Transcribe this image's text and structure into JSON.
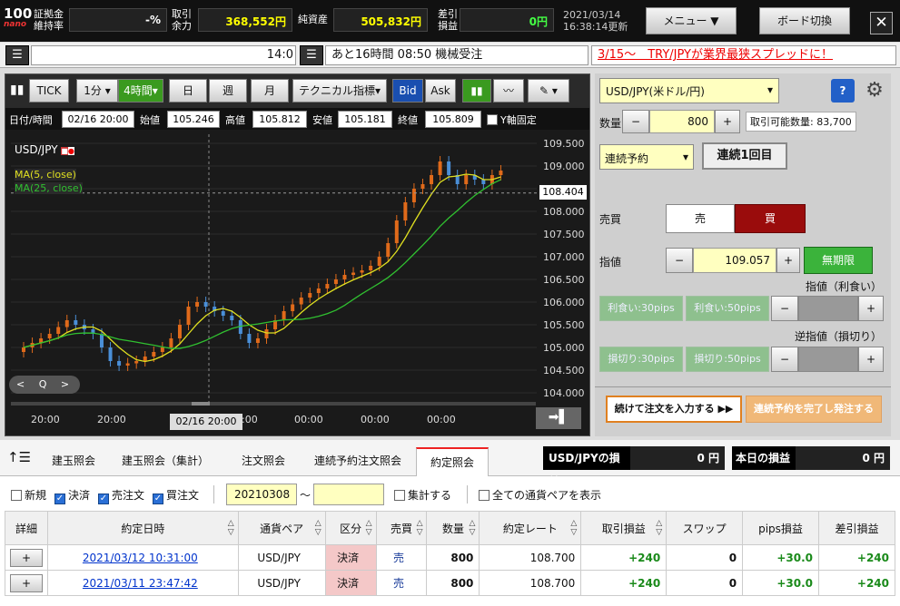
{
  "header": {
    "logo_top": "100",
    "logo_bottom": "nano",
    "margin_label": "証拠金\n維持率",
    "margin_value": "-%",
    "available_label": "取引\n余力",
    "available_value": "368,552円",
    "net_assets_label": "純資産",
    "net_assets_value": "505,832円",
    "pl_label": "差引\n損益",
    "pl_value": "0円",
    "date": "2021/03/14",
    "update_time": "16:38:14更新",
    "menu_button": "メニュー ▼",
    "board_button": "ボード切換",
    "close": "✕"
  },
  "status": {
    "clock": "14:0",
    "message": "あと16時間 08:50 機械受注",
    "ticker": "3/15～　TRY/JPYが業界最狭スプレッドに！"
  },
  "chart_toolbar": {
    "tick": "TICK",
    "min1": "1分",
    "h4": "4時間",
    "day": "日",
    "week": "週",
    "month": "月",
    "technical": "テクニカル指標",
    "bid": "Bid",
    "ask": "Ask"
  },
  "ohlc": {
    "datetime_label": "日付/時間",
    "datetime": "02/16 20:00",
    "open_label": "始値",
    "open": "105.246",
    "high_label": "高値",
    "high": "105.812",
    "low_label": "安値",
    "low": "105.181",
    "close_label": "終値",
    "close": "105.809",
    "yfix": "Y軸固定"
  },
  "chart_labels": {
    "pair": "USD/JPY",
    "ma5": "MA(5, close)",
    "ma25": "MA(25, close)",
    "current_price": "108.404",
    "crosshair_time": "02/16 20:00",
    "nav_left": "<",
    "nav_zoom": "Q",
    "nav_right": ">"
  },
  "chart_data": {
    "type": "candlestick",
    "ylim": [
      103.8,
      109.6
    ],
    "yticks": [
      "109.500",
      "109.000",
      "108.500",
      "108.000",
      "107.500",
      "107.000",
      "106.500",
      "106.000",
      "105.500",
      "105.000",
      "104.500",
      "104.000"
    ],
    "xticks": [
      "20:00",
      "20:00",
      "16:00",
      "00:00",
      "00:00",
      "00:00"
    ],
    "closes": [
      105.0,
      105.1,
      105.2,
      105.3,
      105.45,
      105.6,
      105.5,
      105.4,
      105.3,
      105.0,
      104.7,
      104.6,
      104.65,
      104.7,
      104.8,
      104.9,
      105.0,
      105.2,
      105.5,
      105.9,
      106.0,
      105.9,
      105.8,
      105.7,
      105.6,
      105.3,
      105.1,
      105.2,
      105.4,
      105.6,
      105.8,
      105.95,
      106.1,
      106.2,
      106.3,
      106.4,
      106.5,
      106.6,
      106.65,
      106.7,
      106.8,
      107.0,
      107.3,
      107.8,
      108.2,
      108.5,
      108.6,
      108.8,
      109.1,
      108.8,
      108.6,
      108.8,
      108.7,
      108.6,
      108.8,
      108.9
    ],
    "ma5_color": "#e0e020",
    "ma25_color": "#30c030"
  },
  "order": {
    "pair": "USD/JPY(米ドル/円)",
    "help": "?",
    "qty_label": "数量",
    "qty": "800",
    "available_qty": "取引可能数量: 83,700",
    "order_type": "連続予約",
    "order_count": "連続1回目",
    "side_label": "売買",
    "sell": "売",
    "buy": "買",
    "price_label": "指値",
    "price": "109.057",
    "unlimited": "無期限",
    "limit_label": "指値（利食い）",
    "tp30": "利食い:30pips",
    "tp50": "利食い:50pips",
    "stop_label": "逆指値（損切り）",
    "sl30": "損切り:30pips",
    "sl50": "損切り:50pips",
    "continue_btn": "続けて注文を入力する ▶▶",
    "complete_btn": "連続予約を完了し発注する",
    "minus": "−",
    "plus": "+"
  },
  "tabs": [
    "建玉照会",
    "建玉照会（集計）",
    "注文照会",
    "連続予約注文照会",
    "約定照会"
  ],
  "pnl": {
    "pair_label": "USD/JPYの損益",
    "pair_value": "0 円",
    "today_label": "本日の損益",
    "today_value": "0 円"
  },
  "filters": {
    "new": "新規",
    "settle": "決済",
    "sell": "売注文",
    "buy": "買注文",
    "date_from": "20210308",
    "tilde": "～",
    "aggregate": "集計する",
    "all_pairs": "全ての通貨ペアを表示"
  },
  "table": {
    "headers": [
      "詳細",
      "約定日時",
      "通貨ペア",
      "区分",
      "売買",
      "数量",
      "約定レート",
      "取引損益",
      "スワップ",
      "pips損益",
      "差引損益"
    ],
    "rows": [
      [
        "+",
        "2021/03/12 10:31:00",
        "USD/JPY",
        "決済",
        "売",
        "800",
        "108.700",
        "+240",
        "0",
        "+30.0",
        "+240"
      ],
      [
        "+",
        "2021/03/11 23:47:42",
        "USD/JPY",
        "決済",
        "売",
        "800",
        "108.700",
        "+240",
        "0",
        "+30.0",
        "+240"
      ]
    ]
  }
}
